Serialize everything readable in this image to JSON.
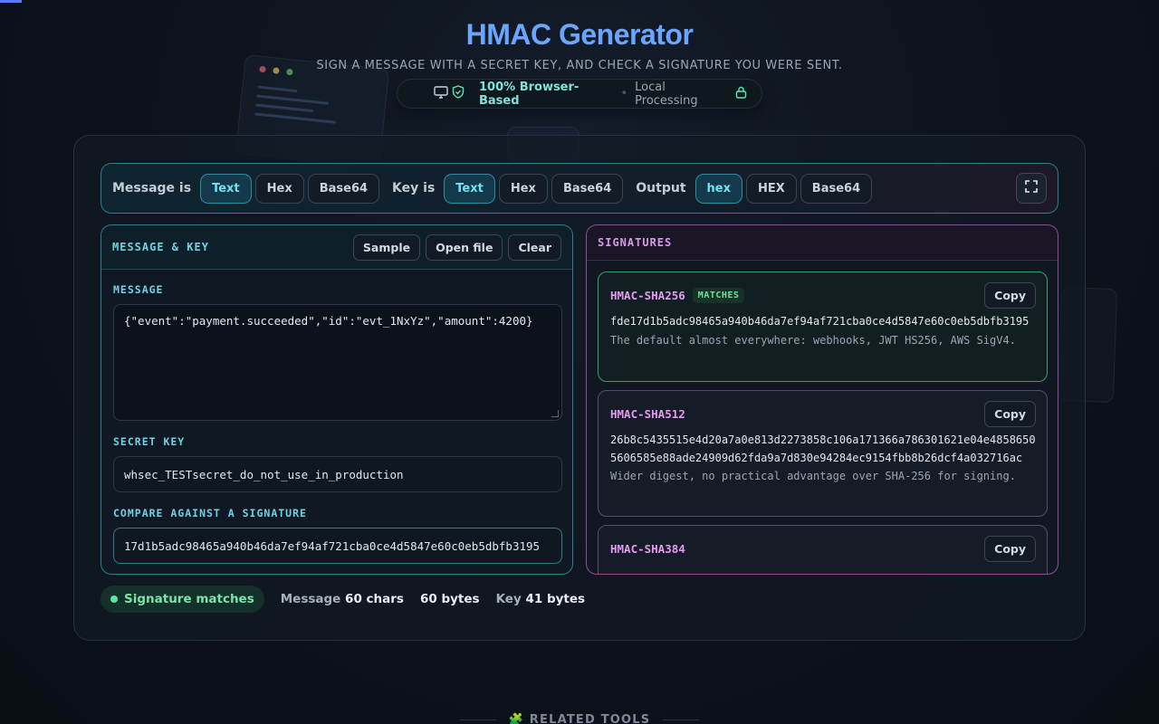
{
  "header": {
    "title": "HMAC Generator",
    "subtitle": "Sign a message with a secret key, and check a signature you were sent.",
    "badge_primary": "100% Browser-Based",
    "badge_secondary": "Local Processing"
  },
  "toolbar": {
    "message_label": "Message is",
    "message_formats": [
      "Text",
      "Hex",
      "Base64"
    ],
    "key_label": "Key is",
    "key_formats": [
      "Text",
      "Hex",
      "Base64"
    ],
    "output_label": "Output",
    "output_formats": [
      "hex",
      "HEX",
      "Base64"
    ]
  },
  "left_panel": {
    "title": "MESSAGE & KEY",
    "sample_label": "Sample",
    "open_file_label": "Open file",
    "clear_label": "Clear",
    "message_label": "MESSAGE",
    "message_value": "{\"event\":\"payment.succeeded\",\"id\":\"evt_1NxYz\",\"amount\":4200}",
    "secret_label": "SECRET KEY",
    "secret_value": "whsec_TESTsecret_do_not_use_in_production",
    "compare_label": "COMPARE AGAINST A SIGNATURE",
    "compare_value": "17d1b5adc98465a940b46da7ef94af721cba0ce4d5847e60c0eb5dbfb3195"
  },
  "right_panel": {
    "title": "SIGNATURES",
    "copy_label": "Copy",
    "signatures": [
      {
        "name": "HMAC-SHA256",
        "badge": "MATCHES",
        "hex": "fde17d1b5adc98465a940b46da7ef94af721cba0ce4d5847e60c0eb5dbfb3195",
        "note": "The default almost everywhere: webhooks, JWT HS256, AWS SigV4."
      },
      {
        "name": "HMAC-SHA512",
        "hex": "26b8c5435515e4d20a7a0e813d2273858c106a171366a786301621e04e48586505606585e88ade24909d62fda9a7d830e94284ec9154fbb8b26dcf4a032716ac",
        "note": "Wider digest, no practical advantage over SHA-256 for signing."
      },
      {
        "name": "HMAC-SHA384",
        "hex": "",
        "note": ""
      }
    ]
  },
  "status": {
    "match_text": "Signature matches",
    "message_prefix": "Message",
    "message_chars": "60 chars",
    "bytes": "60 bytes",
    "key_prefix": "Key",
    "key_bytes": "41 bytes"
  },
  "footer": {
    "related_label": "RELATED TOOLS"
  },
  "colors": {
    "accent_blue": "#6aa6ff",
    "teal": "#6fd3e4",
    "magenta": "#e59af1",
    "match_green": "#7ee3a8"
  }
}
